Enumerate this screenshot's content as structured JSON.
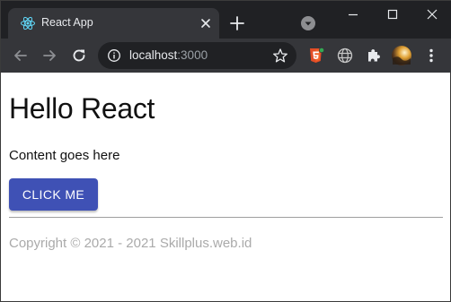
{
  "browser": {
    "tab": {
      "title": "React App",
      "favicon": "react-logo-icon"
    },
    "omnibox": {
      "host": "localhost",
      "port": ":3000"
    },
    "colors": {
      "frame": "#202124",
      "toolbar": "#35363a",
      "react_blue": "#61dafb",
      "html5_orange": "#e44d26"
    },
    "icons": {
      "tab_close": "close-icon",
      "new_tab": "plus-icon",
      "tab_search": "chevron-down-icon",
      "minimize": "minimize-icon",
      "maximize": "maximize-icon",
      "window_close": "close-icon",
      "back": "back-arrow-icon",
      "forward": "forward-arrow-icon",
      "reload": "reload-icon",
      "site_info": "info-icon",
      "bookmark": "star-icon",
      "ext_html5": "html5-extension-icon",
      "ext_globe": "globe-extension-icon",
      "extensions": "puzzle-icon",
      "profile": "avatar",
      "menu": "kebab-menu-icon"
    }
  },
  "page": {
    "heading": "Hello React",
    "body_text": "Content goes here",
    "button_label": "CLICK ME",
    "footer_text": "Copyright © 2021 - 2021 Skillplus.web.id",
    "colors": {
      "button": "#3f51b5",
      "footer_text": "#aaaaaa",
      "divider": "#9e9e9e"
    }
  }
}
